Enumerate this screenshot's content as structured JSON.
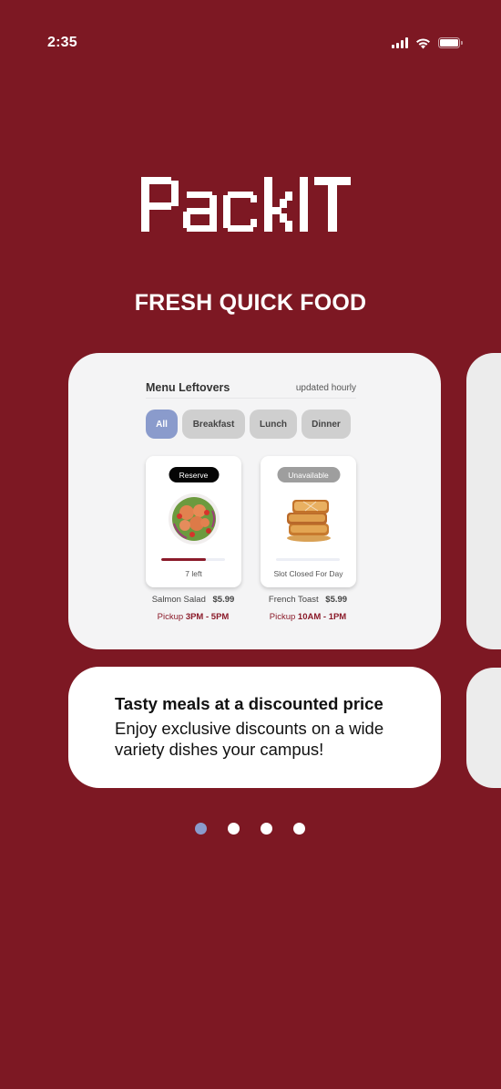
{
  "status_bar": {
    "time": "2:35",
    "icons": [
      "cellular-signal-icon",
      "wifi-icon",
      "battery-icon"
    ]
  },
  "app": {
    "name": "PackIT",
    "tagline": "FRESH QUICK FOOD",
    "brand_color": "#7d1823",
    "accent_color": "#8a9bcc"
  },
  "preview": {
    "menu_title": "Menu Leftovers",
    "menu_subtitle": "updated hourly",
    "filters": [
      {
        "label": "All",
        "active": true
      },
      {
        "label": "Breakfast",
        "active": false
      },
      {
        "label": "Lunch",
        "active": false
      },
      {
        "label": "Dinner",
        "active": false
      }
    ],
    "items": [
      {
        "badge": "Reserve",
        "image": "salmon-salad-image",
        "stock_fraction": 0.7,
        "status": "7 left",
        "name": "Salmon Salad",
        "price": "$5.99",
        "pickup_label": "Pickup",
        "pickup_time": "3PM - 5PM"
      },
      {
        "badge": "Unavailable",
        "image": "french-toast-image",
        "stock_fraction": 0,
        "status": "Slot Closed For Day",
        "name": "French Toast",
        "price": "$5.99",
        "pickup_label": "Pickup",
        "pickup_time": "10AM - 1PM"
      }
    ]
  },
  "info": {
    "title": "Tasty meals at a discounted price",
    "text": "Enjoy exclusive discounts on a wide variety dishes your campus!"
  },
  "pagination": {
    "total": 4,
    "current": 1
  }
}
